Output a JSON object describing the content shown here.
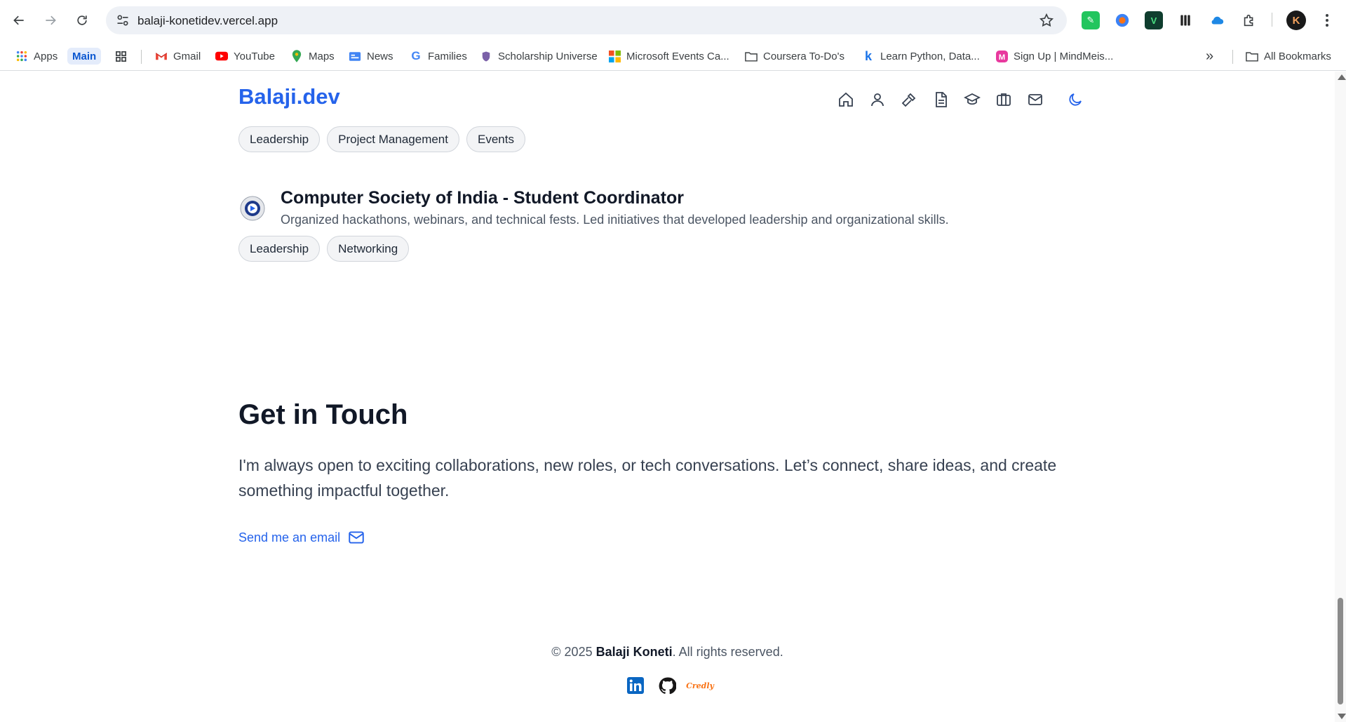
{
  "browser": {
    "url": "balaji-konetidev.vercel.app",
    "profile_initial": "K",
    "bookmarks": [
      {
        "label": "Apps"
      },
      {
        "label": "Main"
      },
      {
        "label": "Gmail"
      },
      {
        "label": "YouTube"
      },
      {
        "label": "Maps"
      },
      {
        "label": "News"
      },
      {
        "label": "Families"
      },
      {
        "label": "Scholarship Universe"
      },
      {
        "label": "Microsoft Events Ca..."
      },
      {
        "label": "Coursera To-Do's"
      },
      {
        "label": "Learn Python, Data..."
      },
      {
        "label": "Sign Up | MindMeis..."
      },
      {
        "label": "All Bookmarks"
      }
    ],
    "more_bookmarks": "»"
  },
  "site": {
    "brand": "Balaji.dev",
    "nav_icons": [
      "home-icon",
      "user-icon",
      "hammer-icon",
      "document-icon",
      "graduation-cap-icon",
      "briefcase-icon",
      "mail-icon",
      "moon-icon"
    ]
  },
  "experience": {
    "previous_tags": [
      "Leadership",
      "Project Management",
      "Events"
    ],
    "title": "Computer Society of India - Student Coordinator",
    "description": "Organized hackathons, webinars, and technical fests. Led initiatives that developed leadership and organizational skills.",
    "tags": [
      "Leadership",
      "Networking"
    ]
  },
  "contact": {
    "title": "Get in Touch",
    "text": "I'm always open to exciting collaborations, new roles, or tech conversations. Let’s connect, share ideas, and create something impactful together.",
    "email_label": "Send me an email"
  },
  "footer": {
    "prefix": "© 2025",
    "name": "Balaji Koneti",
    "suffix": ". All rights reserved.",
    "credly_label": "Credly"
  },
  "colors": {
    "accent": "#2563eb",
    "linkedin": "#0a66c2",
    "credly": "#f97316"
  }
}
